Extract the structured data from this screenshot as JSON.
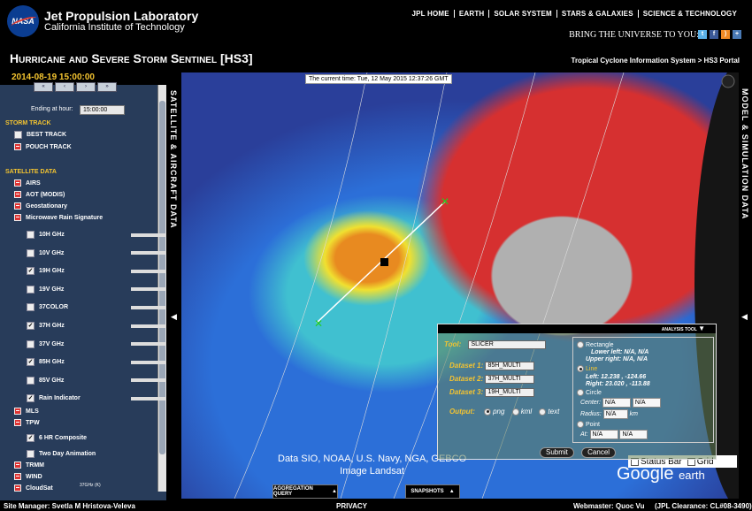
{
  "header": {
    "logo": "NASA",
    "lab_name": "Jet Propulsion Laboratory",
    "lab_sub": "California Institute of Technology",
    "nav": [
      "JPL HOME",
      "EARTH",
      "SOLAR SYSTEM",
      "STARS & GALAXIES",
      "SCIENCE & TECHNOLOGY"
    ],
    "bring": "BRING THE UNIVERSE TO YOU:",
    "social_icons": [
      "twitter-icon",
      "facebook-icon",
      "rss-icon",
      "share-icon"
    ],
    "title": "Hurricane and Severe Storm Sentinel [HS3]",
    "breadcrumb": "Tropical Cyclone Information System > HS3 Portal"
  },
  "viewer": {
    "current_date": "2014-08-19 15:00:00",
    "globe_time": "The current time: Tue, 12 May 2015 12:37:26 GMT",
    "credit_line1": "Data SIO, NOAA, U.S. Navy, NGA, GEBCO",
    "credit_line2": "Image Landsat",
    "google": "Google",
    "earth": "earth",
    "status_bar": "Status Bar",
    "grid": "Grid",
    "aggregation": "AGGREGATION QUERY",
    "snapshots": "SNAPSHOTS"
  },
  "left_panel": {
    "tab_label": "SATELLITE & AIRCRAFT DATA",
    "ending_label": "Ending at hour:",
    "ending_value": "15:00:00",
    "storm_track": "STORM TRACK",
    "best_track": "BEST TRACK",
    "pouch_track": "POUCH TRACK",
    "satellite_data": "SATELLITE DATA",
    "airs": "AIRS",
    "aot": "AOT (MODIS)",
    "geo": "Geostationary",
    "mrs": "Microwave Rain Signature",
    "channels": [
      {
        "label": "10H GHz",
        "checked": false
      },
      {
        "label": "10V GHz",
        "checked": false
      },
      {
        "label": "19H GHz",
        "checked": true
      },
      {
        "label": "19V GHz",
        "checked": false
      },
      {
        "label": "37COLOR",
        "checked": false
      },
      {
        "label": "37H GHz",
        "checked": true
      },
      {
        "label": "37V GHz",
        "checked": false
      },
      {
        "label": "85H GHz",
        "checked": true
      },
      {
        "label": "85V GHz",
        "checked": false
      },
      {
        "label": "Rain Indicator",
        "checked": true
      }
    ],
    "mls": "MLS",
    "tpw": "TPW",
    "composite": "6 HR Composite",
    "animation": "Two Day Animation",
    "trmm": "TRMM",
    "wind": "WIND",
    "cloudsat": "CloudSat",
    "cloudsat_sub": "37GHz (K)"
  },
  "right_panel": {
    "tab_label": "MODEL & SIMULATION DATA"
  },
  "analysis_tool": {
    "header": "ANALYSIS TOOL",
    "tool_label": "Tool:",
    "tool_value": "SLICER",
    "dataset1_label": "Dataset 1:",
    "dataset1": "85H_MULTI",
    "dataset2_label": "Dataset 2:",
    "dataset2": "37H_MULTI",
    "dataset3_label": "Dataset 3:",
    "dataset3": "19H_MULTI",
    "output_label": "Output:",
    "out_png": "png",
    "out_kml": "kml",
    "out_text": "text",
    "rectangle": "Rectangle",
    "rect_lower": "Lower left: N/A, N/A",
    "rect_upper": "Upper right: N/A, N/A",
    "line": "Line",
    "line_left": "Left: 12.238 , -124.66",
    "line_right": "Right: 23.020 , -113.88",
    "circle": "Circle",
    "center_label": "Center:",
    "center_lat": "N/A",
    "center_lon": "N/A",
    "radius_label": "Radius:",
    "radius_value": "N/A",
    "radius_unit": "km",
    "point": "Point",
    "at_label": "At:",
    "at_lat": "N/A",
    "at_lon": "N/A",
    "submit": "Submit",
    "cancel": "Cancel"
  },
  "footer": {
    "site_manager": "Site Manager:  Svetla M Hristova-Veleva",
    "privacy": "PRIVACY",
    "webmaster": "Webmaster:  Quoc Vu",
    "clearance": "(JPL Clearance:  CL#08-3490)"
  }
}
